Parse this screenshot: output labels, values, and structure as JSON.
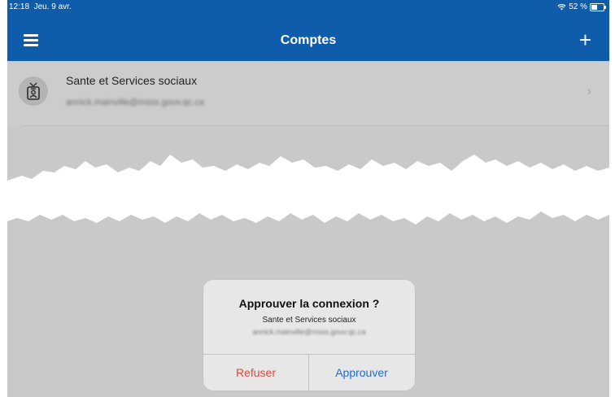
{
  "status_bar": {
    "time": "12:18",
    "date": "Jeu. 9 avr.",
    "battery": "52 %",
    "battery_level": 0.52,
    "wifi_icon": "wifi-icon"
  },
  "nav": {
    "title": "Comptes",
    "menu_icon": "hamburger-menu-icon",
    "add_symbol": "+"
  },
  "account": {
    "name": "Sante et Services sociaux",
    "email": "annick.mainville@msss.gouv.qc.ca",
    "chevron": "›",
    "icon": "id-badge-icon"
  },
  "dialog": {
    "title": "Approuver la connexion ?",
    "organization": "Sante et Services sociaux",
    "email": "annick.mainville@msss.gouv.qc.ca",
    "refuse_label": "Refuser",
    "approve_label": "Approuver"
  },
  "colors": {
    "brand_blue": "#0f5cab",
    "refuse_red": "#e2473b",
    "approve_blue": "#1a6fd6",
    "overlay_gray": "#c9c9c9"
  }
}
